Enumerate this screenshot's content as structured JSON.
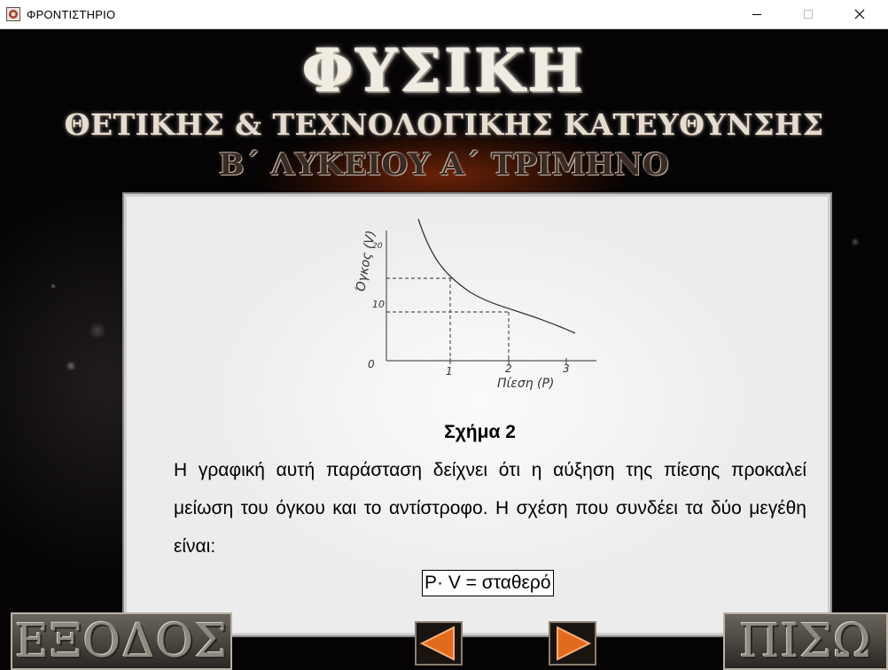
{
  "window": {
    "title": "ΦΡΟΝΤΙΣΤΗΡΙΟ",
    "icon": "app-icon",
    "controls": [
      "minimize-icon",
      "maximize-icon",
      "close-icon"
    ]
  },
  "header": {
    "subject": "ΦΥΣΙΚΗ",
    "track": "ΘΕΤΙΚΗΣ & ΤΕΧΝΟΛΟΓΙΚΗΣ ΚΑΤΕΥΘΥΝΣΗΣ",
    "level": "Β΄ ΛΥΚΕΙΟΥ Α΄ ΤΡΙΜΗΝΟ"
  },
  "content": {
    "graph": {
      "ylabel": "Όγκος (V)",
      "xlabel": "Πίεση (P)",
      "origin_label": "0",
      "y_ticks": [
        "10",
        "20"
      ],
      "x_ticks": [
        "1",
        "2",
        "3"
      ],
      "points": [
        {
          "p": 1,
          "v": 14
        },
        {
          "p": 2,
          "v": 8
        }
      ]
    },
    "caption": "Σχήμα 2",
    "paragraph": "Η γραφική αυτή παράσταση δείχνει ότι η αύξηση της πίεσης προκαλεί μείωση του όγκου και το αντίστροφο. Η σχέση που συνδέει τα δύο μεγέθη είναι:",
    "formula": "P· V = σταθερό"
  },
  "buttons": {
    "exit": "ΕΞΟΔΟΣ",
    "back": "ΠΙΣΩ",
    "prev_icon": "arrow-left-icon",
    "next_icon": "arrow-right-icon"
  },
  "colors": {
    "background": "#050303",
    "panel": "#f2f2f2",
    "arrow": "#e26a1e"
  }
}
